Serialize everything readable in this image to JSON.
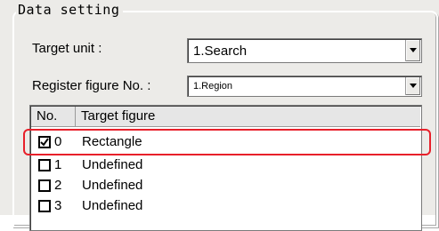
{
  "group": {
    "title": "Data setting"
  },
  "target_unit": {
    "label": "Target unit :",
    "value": "1.Search"
  },
  "register_figure": {
    "label": "Register figure No. :",
    "value": "1.Region"
  },
  "list": {
    "columns": [
      "No.",
      "Target figure"
    ],
    "rows": [
      {
        "no": "0",
        "figure": "Rectangle",
        "checked": true
      },
      {
        "no": "1",
        "figure": "Undefined",
        "checked": false
      },
      {
        "no": "2",
        "figure": "Undefined",
        "checked": false
      },
      {
        "no": "3",
        "figure": "Undefined",
        "checked": false
      }
    ]
  },
  "colors": {
    "highlight": "#e8202a",
    "panel": "#ecebe8"
  },
  "icons": {
    "combo_arrow": "chevron-down-icon",
    "checkbox_mark": "check-icon"
  }
}
